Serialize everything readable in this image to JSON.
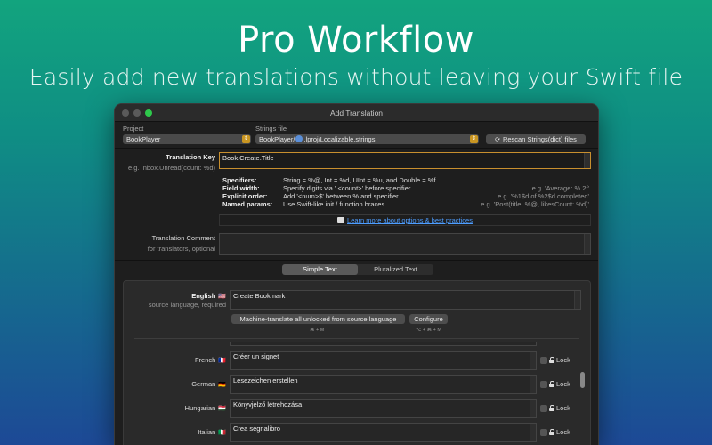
{
  "hero": {
    "title": "Pro Workflow",
    "subtitle": "Easily add new translations without leaving your Swift file"
  },
  "window": {
    "title": "Add Translation"
  },
  "project": {
    "label": "Project",
    "value": "BookPlayer"
  },
  "strings_file": {
    "label": "Strings file",
    "value_prefix": "BookPlayer/",
    "value_suffix": ".lproj/Localizable.strings",
    "rescan_label": "Rescan Strings(dict) files"
  },
  "translation_key": {
    "label": "Translation Key",
    "hint": "e.g. Inbox.Unread(count: %d)",
    "value": "Book.Create.Title"
  },
  "help": {
    "rows": [
      {
        "key": "Specifiers:",
        "value": "String = %@, Int = %d, UInt = %u, and Double = %f",
        "example": ""
      },
      {
        "key": "Field width:",
        "value": "Specify digits via '.<count>' before specifier",
        "example": "e.g. 'Average: %.2f'"
      },
      {
        "key": "Explicit order:",
        "value": "Add '<num>$' between % and specifier",
        "example": "e.g. '%1$d of %2$d completed'"
      },
      {
        "key": "Named params:",
        "value": "Use Swift-like init / function braces",
        "example": "e.g. 'Post(title: %@, likesCount: %d)'"
      }
    ],
    "link": "Learn more about options & best practices"
  },
  "comment": {
    "label": "Translation Comment",
    "hint": "for translators, optional",
    "value": ""
  },
  "tabs": {
    "simple": "Simple Text",
    "pluralized": "Pluralized Text"
  },
  "source": {
    "language": "English",
    "flag": "🇺🇸",
    "hint": "source language, required",
    "value": "Create Bookmark",
    "machine_translate": "Machine-translate all unlocked from source language",
    "machine_shortcut": "⌘ + M",
    "configure": "Configure",
    "configure_shortcut": "⌥ + ⌘ + M"
  },
  "lock_label": "Lock",
  "translations": [
    {
      "language": "French",
      "flag": "🇫🇷",
      "value": "Créer un signet"
    },
    {
      "language": "German",
      "flag": "🇩🇪",
      "value": "Lesezeichen erstellen"
    },
    {
      "language": "Hungarian",
      "flag": "🇭🇺",
      "value": "Könyvjelző létrehozása"
    },
    {
      "language": "Italian",
      "flag": "🇮🇹",
      "value": "Crea segnalibro"
    }
  ]
}
